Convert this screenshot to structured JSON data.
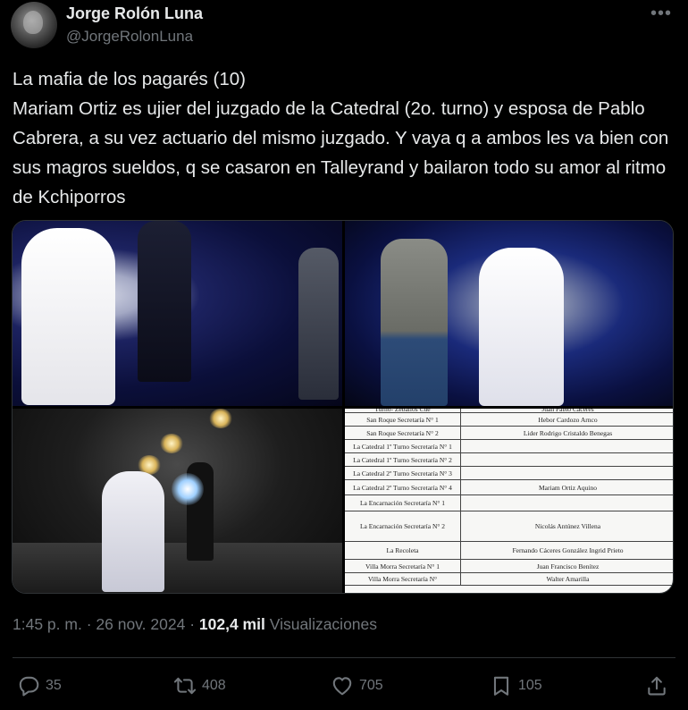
{
  "author": {
    "name": "Jorge Rolón Luna",
    "handle": "@JorgeRolonLuna"
  },
  "tweet": {
    "text": "La mafia de los pagarés (10)\nMariam Ortiz es ujier del juzgado de la Catedral (2o. turno) y esposa de Pablo Cabrera, a su vez actuario del mismo juzgado. Y vaya q a ambos les va bien con sus magros sueldos, q se casaron en Talleyrand y bailaron todo su amor al ritmo de Kchiporros"
  },
  "document": {
    "rows": [
      {
        "c1": "Turno- Zeballos Cue",
        "c2": "Juan Pablo Cáceres"
      },
      {
        "c1": "San Roque Secretaría N° 1",
        "c2": "Hebor Cardozo Arnco"
      },
      {
        "c1": "San Roque Secretaría N° 2",
        "c2": "Lider Rodrigo Cristaldo Benegas"
      },
      {
        "c1": "La Catedral 1º Turno Secretaría N° 1",
        "c2": ""
      },
      {
        "c1": "La Catedral 1º Turno Secretaría N° 2",
        "c2": ""
      },
      {
        "c1": "La Catedral 2º Turno Secretaría N° 3",
        "c2": ""
      },
      {
        "c1": "La Catedral 2º Turno Secretaría N° 4",
        "c2": "Mariam Ortiz Aquino"
      },
      {
        "c1": "La Encarnación Secretaría N° 1",
        "c2": ""
      },
      {
        "c1": "La Encarnación Secretaría N° 2",
        "c2": "Nicolás Antúnez Villena"
      },
      {
        "c1": "La Recoleta",
        "c2": "Fernando Cáceres González Ingrid Prieto"
      },
      {
        "c1": "Villa Morra Secretaría N° 1",
        "c2": "Juan Francisco Benítez"
      },
      {
        "c1": "Villa Morra Secretaría N°",
        "c2": "Walter Amarilla"
      }
    ]
  },
  "meta": {
    "time": "1:45 p. m.",
    "separator": "·",
    "date": "26 nov. 2024",
    "views_count": "102,4 mil",
    "views_label": "Visualizaciones"
  },
  "actions": {
    "replies": "35",
    "reposts": "408",
    "likes": "705",
    "bookmarks": "105"
  },
  "icons": {
    "more": "more-icon",
    "reply": "reply-icon",
    "repost": "repost-icon",
    "like": "heart-icon",
    "bookmark": "bookmark-icon",
    "share": "share-icon"
  },
  "colors": {
    "background": "#000000",
    "text": "#e7e9ea",
    "muted": "#71767b",
    "border": "#2f3336"
  }
}
